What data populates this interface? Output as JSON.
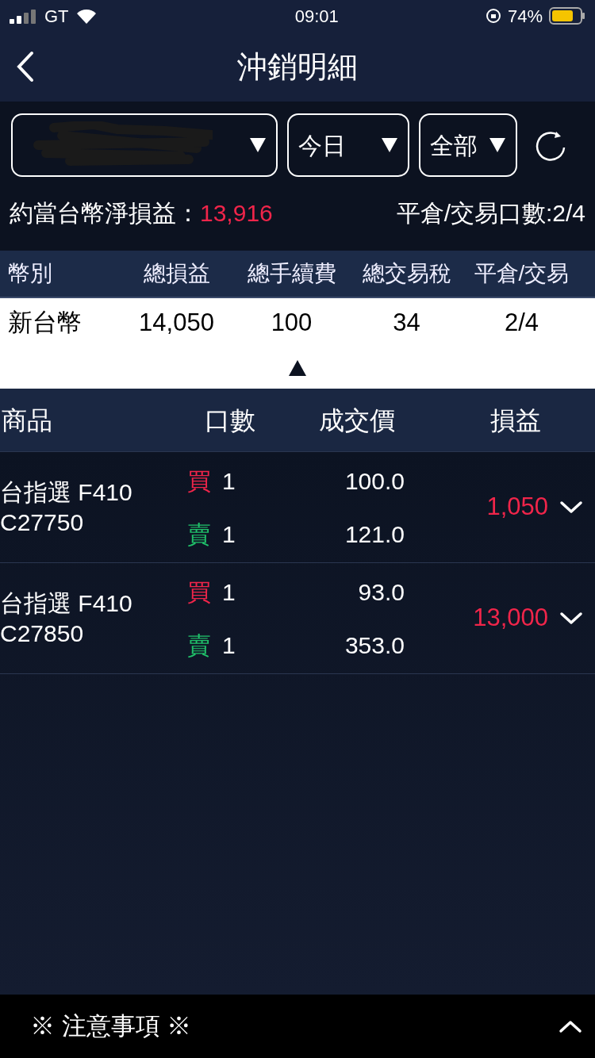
{
  "status_bar": {
    "carrier": "GT",
    "time": "09:01",
    "battery": "74%"
  },
  "header": {
    "title": "沖銷明細"
  },
  "filters": [
    {
      "kind": "account"
    },
    {
      "kind": "select",
      "label": "今日"
    },
    {
      "kind": "select",
      "label": "全部"
    }
  ],
  "summary": {
    "label": "約當台幣淨損益：",
    "value": "13,916",
    "count": "平倉/交易口數:2/4"
  },
  "currency_table": {
    "columns": [
      "幣別",
      "總損益",
      "總手續費",
      "總交易稅",
      "平倉/交易"
    ],
    "rows": [
      [
        "新台幣",
        "14,050",
        "100",
        "34",
        "2/4"
      ]
    ],
    "expanded": true
  },
  "detail_table": {
    "columns": [
      "商品",
      "口數",
      "成交價",
      "損益"
    ],
    "rows": [
      {
        "product": [
          "台指選 F410",
          "C27750"
        ],
        "legs": [
          {
            "side": "買",
            "kind": "buy",
            "qty": "1",
            "price": "100.0"
          },
          {
            "side": "賣",
            "kind": "sell",
            "qty": "1",
            "price": "121.0"
          }
        ],
        "pnl": "1,050",
        "expanded": false
      },
      {
        "product": [
          "台指選 F410",
          "C27850"
        ],
        "legs": [
          {
            "side": "買",
            "kind": "buy",
            "qty": "1",
            "price": "93.0"
          },
          {
            "side": "賣",
            "kind": "sell",
            "qty": "1",
            "price": "353.0"
          }
        ],
        "pnl": "13,000",
        "expanded": false
      }
    ]
  },
  "footer": {
    "label": "※ 注意事項 ※",
    "expanded": false
  }
}
